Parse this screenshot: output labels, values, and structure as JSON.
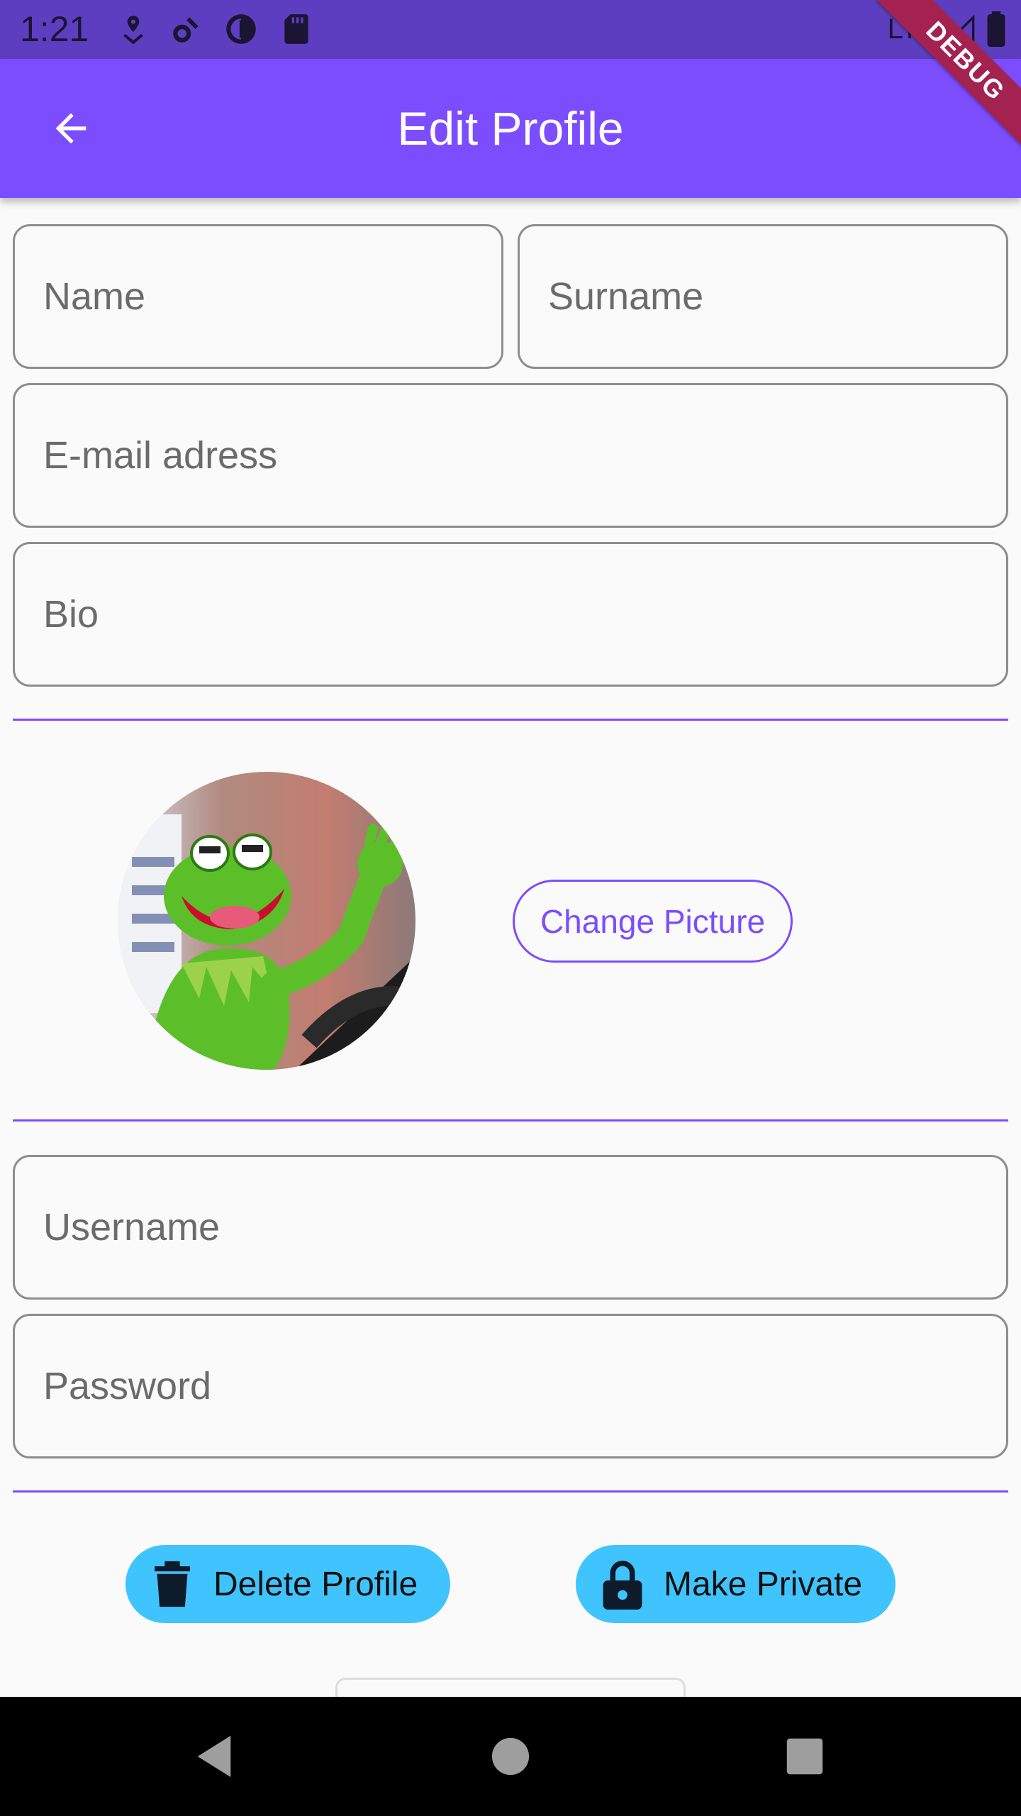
{
  "status_bar": {
    "time": "1:21",
    "network": "LTE",
    "icons": [
      "location-icon",
      "settings-icon",
      "data-saver-icon",
      "sd-card-icon",
      "signal-icon",
      "battery-icon"
    ]
  },
  "app_bar": {
    "title": "Edit Profile",
    "back_icon": "arrow-back-icon"
  },
  "debug_banner": "DEBUG",
  "form": {
    "name_placeholder": "Name",
    "surname_placeholder": "Surname",
    "email_placeholder": "E-mail adress",
    "bio_placeholder": "Bio",
    "username_placeholder": "Username",
    "password_placeholder": "Password"
  },
  "picture": {
    "change_label": "Change Picture"
  },
  "actions": {
    "delete_label": "Delete Profile",
    "delete_icon": "trash-icon",
    "private_label": "Make Private",
    "private_icon": "lock-icon"
  },
  "colors": {
    "primary": "#7c4dff",
    "status_bar": "#5e3ec0",
    "accent": "#40c4ff",
    "debug": "#a4224f"
  },
  "nav_bar": {
    "icons": [
      "back-triangle-icon",
      "home-circle-icon",
      "recents-square-icon"
    ]
  }
}
